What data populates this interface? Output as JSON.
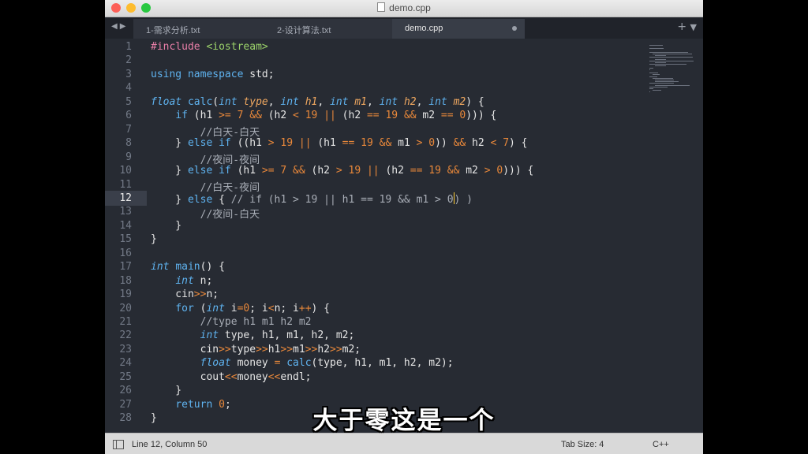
{
  "window": {
    "title": "demo.cpp"
  },
  "tabs": [
    {
      "label": "1-需求分析.txt",
      "active": false
    },
    {
      "label": "2-设计算法.txt",
      "active": false
    },
    {
      "label": "demo.cpp",
      "active": true
    }
  ],
  "editor": {
    "current_line": 12,
    "lines": [
      [
        [
          "pp",
          "#include "
        ],
        [
          "hdr",
          "<iostream>"
        ]
      ],
      [],
      [
        [
          "kw2",
          "using"
        ],
        [
          "t",
          " "
        ],
        [
          "kw2",
          "namespace"
        ],
        [
          "t",
          " std;"
        ]
      ],
      [],
      [
        [
          "kw",
          "float"
        ],
        [
          "t",
          " "
        ],
        [
          "fn",
          "calc"
        ],
        [
          "t",
          "("
        ],
        [
          "kw",
          "int"
        ],
        [
          "t",
          " "
        ],
        [
          "par",
          "type"
        ],
        [
          "t",
          ", "
        ],
        [
          "kw",
          "int"
        ],
        [
          "t",
          " "
        ],
        [
          "par",
          "h1"
        ],
        [
          "t",
          ", "
        ],
        [
          "kw",
          "int"
        ],
        [
          "t",
          " "
        ],
        [
          "par",
          "m1"
        ],
        [
          "t",
          ", "
        ],
        [
          "kw",
          "int"
        ],
        [
          "t",
          " "
        ],
        [
          "par",
          "h2"
        ],
        [
          "t",
          ", "
        ],
        [
          "kw",
          "int"
        ],
        [
          "t",
          " "
        ],
        [
          "par",
          "m2"
        ],
        [
          "t",
          ") {"
        ]
      ],
      [
        [
          "t",
          "    "
        ],
        [
          "kw2",
          "if"
        ],
        [
          "t",
          " (h1 "
        ],
        [
          "op",
          ">="
        ],
        [
          "t",
          " "
        ],
        [
          "num",
          "7"
        ],
        [
          "t",
          " "
        ],
        [
          "op",
          "&&"
        ],
        [
          "t",
          " (h2 "
        ],
        [
          "op",
          "<"
        ],
        [
          "t",
          " "
        ],
        [
          "num",
          "19"
        ],
        [
          "t",
          " "
        ],
        [
          "op",
          "||"
        ],
        [
          "t",
          " (h2 "
        ],
        [
          "op",
          "=="
        ],
        [
          "t",
          " "
        ],
        [
          "num",
          "19"
        ],
        [
          "t",
          " "
        ],
        [
          "op",
          "&&"
        ],
        [
          "t",
          " m2 "
        ],
        [
          "op",
          "=="
        ],
        [
          "t",
          " "
        ],
        [
          "num",
          "0"
        ],
        [
          "t",
          "))) {"
        ]
      ],
      [
        [
          "t",
          "        "
        ],
        [
          "cmt",
          "//白天-白天"
        ]
      ],
      [
        [
          "t",
          "    } "
        ],
        [
          "kw2",
          "else"
        ],
        [
          "t",
          " "
        ],
        [
          "kw2",
          "if"
        ],
        [
          "t",
          " ((h1 "
        ],
        [
          "op",
          ">"
        ],
        [
          "t",
          " "
        ],
        [
          "num",
          "19"
        ],
        [
          "t",
          " "
        ],
        [
          "op",
          "||"
        ],
        [
          "t",
          " (h1 "
        ],
        [
          "op",
          "=="
        ],
        [
          "t",
          " "
        ],
        [
          "num",
          "19"
        ],
        [
          "t",
          " "
        ],
        [
          "op",
          "&&"
        ],
        [
          "t",
          " m1 "
        ],
        [
          "op",
          ">"
        ],
        [
          "t",
          " "
        ],
        [
          "num",
          "0"
        ],
        [
          "t",
          ")) "
        ],
        [
          "op",
          "&&"
        ],
        [
          "t",
          " h2 "
        ],
        [
          "op",
          "<"
        ],
        [
          "t",
          " "
        ],
        [
          "num",
          "7"
        ],
        [
          "t",
          ") {"
        ]
      ],
      [
        [
          "t",
          "        "
        ],
        [
          "cmt",
          "//夜间-夜间"
        ]
      ],
      [
        [
          "t",
          "    } "
        ],
        [
          "kw2",
          "else"
        ],
        [
          "t",
          " "
        ],
        [
          "kw2",
          "if"
        ],
        [
          "t",
          " (h1 "
        ],
        [
          "op",
          ">="
        ],
        [
          "t",
          " "
        ],
        [
          "num",
          "7"
        ],
        [
          "t",
          " "
        ],
        [
          "op",
          "&&"
        ],
        [
          "t",
          " (h2 "
        ],
        [
          "op",
          ">"
        ],
        [
          "t",
          " "
        ],
        [
          "num",
          "19"
        ],
        [
          "t",
          " "
        ],
        [
          "op",
          "||"
        ],
        [
          "t",
          " (h2 "
        ],
        [
          "op",
          "=="
        ],
        [
          "t",
          " "
        ],
        [
          "num",
          "19"
        ],
        [
          "t",
          " "
        ],
        [
          "op",
          "&&"
        ],
        [
          "t",
          " m2 "
        ],
        [
          "op",
          ">"
        ],
        [
          "t",
          " "
        ],
        [
          "num",
          "0"
        ],
        [
          "t",
          "))) {"
        ]
      ],
      [
        [
          "t",
          "        "
        ],
        [
          "cmt",
          "//白天-夜间"
        ]
      ],
      [
        [
          "t",
          "    } "
        ],
        [
          "kw2",
          "else"
        ],
        [
          "t",
          " { "
        ],
        [
          "cmt",
          "// if (h1 > 19 || h1 == 19 && m1 > 0"
        ],
        [
          "cursor",
          ""
        ],
        [
          "cmt",
          ") )"
        ]
      ],
      [
        [
          "t",
          "        "
        ],
        [
          "cmt",
          "//夜间-白天"
        ]
      ],
      [
        [
          "t",
          "    }"
        ]
      ],
      [
        [
          "t",
          "}"
        ]
      ],
      [],
      [
        [
          "kw",
          "int"
        ],
        [
          "t",
          " "
        ],
        [
          "fn",
          "main"
        ],
        [
          "t",
          "() {"
        ]
      ],
      [
        [
          "t",
          "    "
        ],
        [
          "kw",
          "int"
        ],
        [
          "t",
          " n;"
        ]
      ],
      [
        [
          "t",
          "    cin"
        ],
        [
          "op",
          ">>"
        ],
        [
          "t",
          "n;"
        ]
      ],
      [
        [
          "t",
          "    "
        ],
        [
          "kw2",
          "for"
        ],
        [
          "t",
          " ("
        ],
        [
          "kw",
          "int"
        ],
        [
          "t",
          " i"
        ],
        [
          "op",
          "="
        ],
        [
          "num",
          "0"
        ],
        [
          "t",
          "; i"
        ],
        [
          "op",
          "<"
        ],
        [
          "t",
          "n; i"
        ],
        [
          "op",
          "++"
        ],
        [
          "t",
          ") {"
        ]
      ],
      [
        [
          "t",
          "        "
        ],
        [
          "cmt",
          "//type h1 m1 h2 m2"
        ]
      ],
      [
        [
          "t",
          "        "
        ],
        [
          "kw",
          "int"
        ],
        [
          "t",
          " type, h1, m1, h2, m2;"
        ]
      ],
      [
        [
          "t",
          "        cin"
        ],
        [
          "op",
          ">>"
        ],
        [
          "t",
          "type"
        ],
        [
          "op",
          ">>"
        ],
        [
          "t",
          "h1"
        ],
        [
          "op",
          ">>"
        ],
        [
          "t",
          "m1"
        ],
        [
          "op",
          ">>"
        ],
        [
          "t",
          "h2"
        ],
        [
          "op",
          ">>"
        ],
        [
          "t",
          "m2;"
        ]
      ],
      [
        [
          "t",
          "        "
        ],
        [
          "kw",
          "float"
        ],
        [
          "t",
          " money "
        ],
        [
          "op",
          "="
        ],
        [
          "t",
          " "
        ],
        [
          "fn",
          "calc"
        ],
        [
          "t",
          "(type, h1, m1, h2, m2);"
        ]
      ],
      [
        [
          "t",
          "        cout"
        ],
        [
          "op",
          "<<"
        ],
        [
          "t",
          "money"
        ],
        [
          "op",
          "<<"
        ],
        [
          "t",
          "endl;"
        ]
      ],
      [
        [
          "t",
          "    }"
        ]
      ],
      [
        [
          "t",
          "    "
        ],
        [
          "kw2",
          "return"
        ],
        [
          "t",
          " "
        ],
        [
          "num",
          "0"
        ],
        [
          "t",
          ";"
        ]
      ],
      [
        [
          "t",
          "}"
        ]
      ]
    ]
  },
  "status": {
    "position": "Line 12, Column 50",
    "tab_size": "Tab Size: 4",
    "language": "C++"
  },
  "subtitle": "大于零这是一个",
  "icons": {
    "traffic_lights": [
      "close-icon",
      "minimize-icon",
      "zoom-icon"
    ],
    "nav": "tab-nav-arrows-icon",
    "new_tab": "plus-icon",
    "tab_menu": "chevron-down-icon",
    "sidebar": "sidebar-toggle-icon"
  },
  "colors": {
    "background": "#272b33",
    "keyword": "#5fb3f0",
    "operator": "#e9883a",
    "string": "#9bd26a",
    "preprocessor": "#e97fa8"
  }
}
